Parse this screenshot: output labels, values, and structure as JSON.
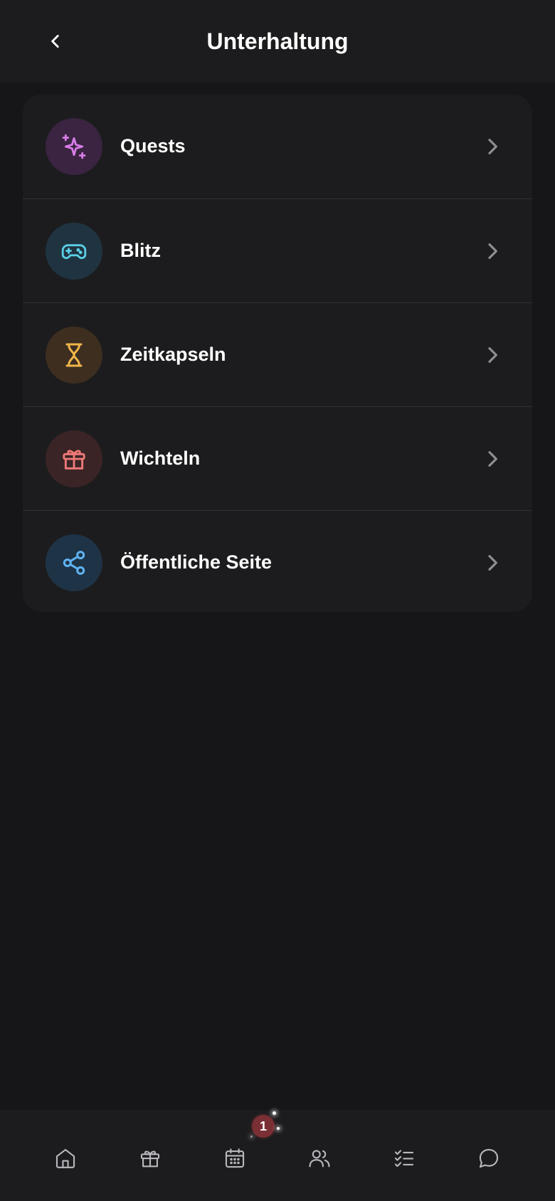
{
  "header": {
    "title": "Unterhaltung",
    "back_icon": "chevron-left-icon"
  },
  "menu": {
    "items": [
      {
        "label": "Quests",
        "icon": "sparkles-icon",
        "icon_color": "#d77ce6",
        "circle_color": "#3a2441"
      },
      {
        "label": "Blitz",
        "icon": "gamepad-icon",
        "icon_color": "#5ccfe6",
        "circle_color": "#1f3440"
      },
      {
        "label": "Zeitkapseln",
        "icon": "hourglass-icon",
        "icon_color": "#f0b64a",
        "circle_color": "#3d2e20"
      },
      {
        "label": "Wichteln",
        "icon": "gift-icon",
        "icon_color": "#f07a78",
        "circle_color": "#3b2426"
      },
      {
        "label": "Öffentliche Seite",
        "icon": "share-icon",
        "icon_color": "#5eb3f2",
        "circle_color": "#1f3346"
      }
    ]
  },
  "bottom_nav": {
    "items": [
      {
        "icon": "home-icon"
      },
      {
        "icon": "gift-icon"
      },
      {
        "icon": "calendar-icon",
        "badge": "1"
      },
      {
        "icon": "users-icon"
      },
      {
        "icon": "checklist-icon"
      },
      {
        "icon": "chat-icon"
      }
    ]
  },
  "colors": {
    "background": "#161618",
    "surface": "#1c1c1e",
    "divider": "#303034",
    "chevron": "#8e8e93",
    "nav_icon": "#b7b7bd",
    "badge": "#7a2f34"
  }
}
